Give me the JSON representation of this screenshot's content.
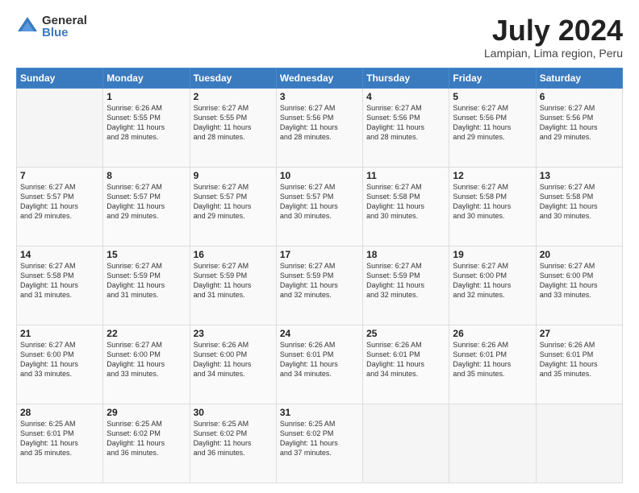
{
  "logo": {
    "general": "General",
    "blue": "Blue"
  },
  "title": "July 2024",
  "location": "Lampian, Lima region, Peru",
  "days_of_week": [
    "Sunday",
    "Monday",
    "Tuesday",
    "Wednesday",
    "Thursday",
    "Friday",
    "Saturday"
  ],
  "weeks": [
    [
      {
        "day": "",
        "info": ""
      },
      {
        "day": "1",
        "info": "Sunrise: 6:26 AM\nSunset: 5:55 PM\nDaylight: 11 hours\nand 28 minutes."
      },
      {
        "day": "2",
        "info": "Sunrise: 6:27 AM\nSunset: 5:55 PM\nDaylight: 11 hours\nand 28 minutes."
      },
      {
        "day": "3",
        "info": "Sunrise: 6:27 AM\nSunset: 5:56 PM\nDaylight: 11 hours\nand 28 minutes."
      },
      {
        "day": "4",
        "info": "Sunrise: 6:27 AM\nSunset: 5:56 PM\nDaylight: 11 hours\nand 28 minutes."
      },
      {
        "day": "5",
        "info": "Sunrise: 6:27 AM\nSunset: 5:56 PM\nDaylight: 11 hours\nand 29 minutes."
      },
      {
        "day": "6",
        "info": "Sunrise: 6:27 AM\nSunset: 5:56 PM\nDaylight: 11 hours\nand 29 minutes."
      }
    ],
    [
      {
        "day": "7",
        "info": "Sunrise: 6:27 AM\nSunset: 5:57 PM\nDaylight: 11 hours\nand 29 minutes."
      },
      {
        "day": "8",
        "info": "Sunrise: 6:27 AM\nSunset: 5:57 PM\nDaylight: 11 hours\nand 29 minutes."
      },
      {
        "day": "9",
        "info": "Sunrise: 6:27 AM\nSunset: 5:57 PM\nDaylight: 11 hours\nand 29 minutes."
      },
      {
        "day": "10",
        "info": "Sunrise: 6:27 AM\nSunset: 5:57 PM\nDaylight: 11 hours\nand 30 minutes."
      },
      {
        "day": "11",
        "info": "Sunrise: 6:27 AM\nSunset: 5:58 PM\nDaylight: 11 hours\nand 30 minutes."
      },
      {
        "day": "12",
        "info": "Sunrise: 6:27 AM\nSunset: 5:58 PM\nDaylight: 11 hours\nand 30 minutes."
      },
      {
        "day": "13",
        "info": "Sunrise: 6:27 AM\nSunset: 5:58 PM\nDaylight: 11 hours\nand 30 minutes."
      }
    ],
    [
      {
        "day": "14",
        "info": "Sunrise: 6:27 AM\nSunset: 5:58 PM\nDaylight: 11 hours\nand 31 minutes."
      },
      {
        "day": "15",
        "info": "Sunrise: 6:27 AM\nSunset: 5:59 PM\nDaylight: 11 hours\nand 31 minutes."
      },
      {
        "day": "16",
        "info": "Sunrise: 6:27 AM\nSunset: 5:59 PM\nDaylight: 11 hours\nand 31 minutes."
      },
      {
        "day": "17",
        "info": "Sunrise: 6:27 AM\nSunset: 5:59 PM\nDaylight: 11 hours\nand 32 minutes."
      },
      {
        "day": "18",
        "info": "Sunrise: 6:27 AM\nSunset: 5:59 PM\nDaylight: 11 hours\nand 32 minutes."
      },
      {
        "day": "19",
        "info": "Sunrise: 6:27 AM\nSunset: 6:00 PM\nDaylight: 11 hours\nand 32 minutes."
      },
      {
        "day": "20",
        "info": "Sunrise: 6:27 AM\nSunset: 6:00 PM\nDaylight: 11 hours\nand 33 minutes."
      }
    ],
    [
      {
        "day": "21",
        "info": "Sunrise: 6:27 AM\nSunset: 6:00 PM\nDaylight: 11 hours\nand 33 minutes."
      },
      {
        "day": "22",
        "info": "Sunrise: 6:27 AM\nSunset: 6:00 PM\nDaylight: 11 hours\nand 33 minutes."
      },
      {
        "day": "23",
        "info": "Sunrise: 6:26 AM\nSunset: 6:00 PM\nDaylight: 11 hours\nand 34 minutes."
      },
      {
        "day": "24",
        "info": "Sunrise: 6:26 AM\nSunset: 6:01 PM\nDaylight: 11 hours\nand 34 minutes."
      },
      {
        "day": "25",
        "info": "Sunrise: 6:26 AM\nSunset: 6:01 PM\nDaylight: 11 hours\nand 34 minutes."
      },
      {
        "day": "26",
        "info": "Sunrise: 6:26 AM\nSunset: 6:01 PM\nDaylight: 11 hours\nand 35 minutes."
      },
      {
        "day": "27",
        "info": "Sunrise: 6:26 AM\nSunset: 6:01 PM\nDaylight: 11 hours\nand 35 minutes."
      }
    ],
    [
      {
        "day": "28",
        "info": "Sunrise: 6:25 AM\nSunset: 6:01 PM\nDaylight: 11 hours\nand 35 minutes."
      },
      {
        "day": "29",
        "info": "Sunrise: 6:25 AM\nSunset: 6:02 PM\nDaylight: 11 hours\nand 36 minutes."
      },
      {
        "day": "30",
        "info": "Sunrise: 6:25 AM\nSunset: 6:02 PM\nDaylight: 11 hours\nand 36 minutes."
      },
      {
        "day": "31",
        "info": "Sunrise: 6:25 AM\nSunset: 6:02 PM\nDaylight: 11 hours\nand 37 minutes."
      },
      {
        "day": "",
        "info": ""
      },
      {
        "day": "",
        "info": ""
      },
      {
        "day": "",
        "info": ""
      }
    ]
  ]
}
